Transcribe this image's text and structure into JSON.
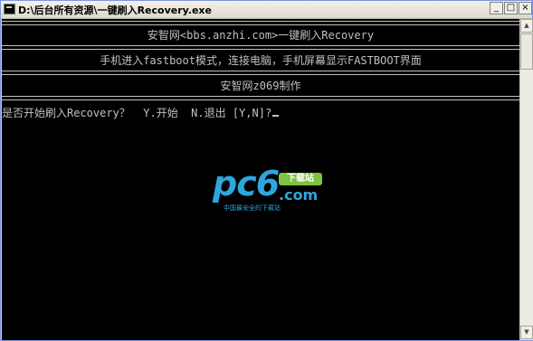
{
  "window": {
    "title": "D:\\后台所有资源\\一键刷入Recovery.exe",
    "minimize_glyph": "_",
    "maximize_glyph": "□",
    "close_glyph": "×"
  },
  "console": {
    "banner1": "安智网<bbs.anzhi.com>一键刷入Recovery",
    "banner2": "手机进入fastboot模式，连接电脑，手机屏幕显示FASTBOOT界面",
    "banner3": "安智网z069制作",
    "prompt": "是否开始刷入Recovery？  Y.开始  N.退出 [Y,N]?"
  },
  "watermark": {
    "brand": "pc6",
    "badge": "下载站",
    "domain": ".com",
    "slogan": "中国最安全的下载站"
  },
  "colors": {
    "console_bg": "#000000",
    "console_fg": "#c0c0c0",
    "watermark_blue": "#2ea6df",
    "watermark_green": "#7dc243"
  }
}
